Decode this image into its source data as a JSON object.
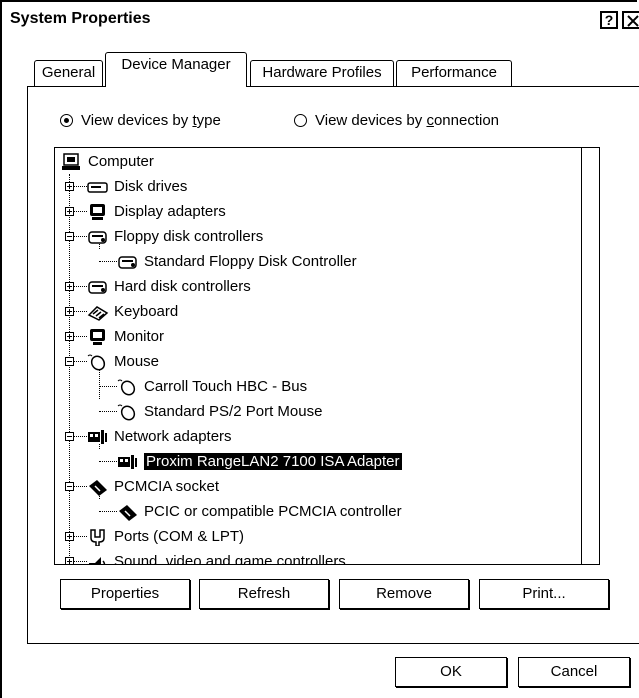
{
  "window": {
    "title": "System Properties",
    "help_label": "?",
    "close_icon": "close-icon"
  },
  "tabs": [
    {
      "label": "General"
    },
    {
      "label": "Device Manager"
    },
    {
      "label": "Hardware Profiles"
    },
    {
      "label": "Performance"
    }
  ],
  "view": {
    "by_type": "View devices by type",
    "by_connection": "View devices by connection",
    "selected": "by_type"
  },
  "tree": {
    "items": [
      {
        "label": "Computer",
        "icon": "computer-icon",
        "level": 0
      },
      {
        "label": "Disk drives",
        "icon": "disk-drive-icon",
        "level": 1,
        "expander": "plus"
      },
      {
        "label": "Display adapters",
        "icon": "display-adapter-icon",
        "level": 1,
        "expander": "plus"
      },
      {
        "label": "Floppy disk controllers",
        "icon": "controller-icon",
        "level": 1,
        "expander": "minus"
      },
      {
        "label": "Standard Floppy Disk Controller",
        "icon": "controller-icon",
        "level": 2
      },
      {
        "label": "Hard disk controllers",
        "icon": "controller-icon",
        "level": 1,
        "expander": "plus"
      },
      {
        "label": "Keyboard",
        "icon": "keyboard-icon",
        "level": 1,
        "expander": "plus"
      },
      {
        "label": "Monitor",
        "icon": "monitor-icon",
        "level": 1,
        "expander": "plus"
      },
      {
        "label": "Mouse",
        "icon": "mouse-icon",
        "level": 1,
        "expander": "minus"
      },
      {
        "label": "Carroll Touch HBC - Bus",
        "icon": "mouse-icon",
        "level": 2
      },
      {
        "label": "Standard PS/2 Port Mouse",
        "icon": "mouse-icon",
        "level": 2
      },
      {
        "label": "Network adapters",
        "icon": "network-adapter-icon",
        "level": 1,
        "expander": "minus"
      },
      {
        "label": "Proxim RangeLAN2 7100 ISA Adapter",
        "icon": "network-adapter-icon",
        "level": 2,
        "selected": true
      },
      {
        "label": "PCMCIA socket",
        "icon": "pcmcia-icon",
        "level": 1,
        "expander": "minus"
      },
      {
        "label": "PCIC or compatible PCMCIA controller",
        "icon": "pcmcia-icon",
        "level": 2
      },
      {
        "label": "Ports (COM & LPT)",
        "icon": "port-icon",
        "level": 1,
        "expander": "plus"
      },
      {
        "label": "Sound, video and game controllers",
        "icon": "sound-icon",
        "level": 1,
        "expander": "plus"
      }
    ]
  },
  "buttons": {
    "properties": "Properties",
    "refresh": "Refresh",
    "remove": "Remove",
    "print": "Print...",
    "ok": "OK",
    "cancel": "Cancel"
  }
}
